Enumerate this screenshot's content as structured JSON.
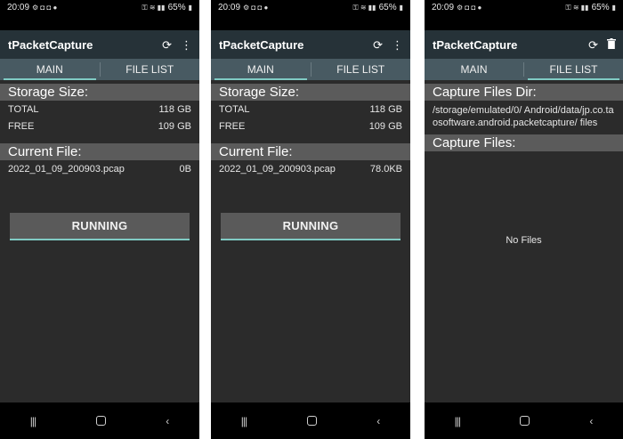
{
  "status": {
    "time": "20:09",
    "battery": "65%"
  },
  "app": {
    "title": "tPacketCapture"
  },
  "tabs": {
    "main": "MAIN",
    "file_list": "FILE LIST"
  },
  "main_screens": [
    {
      "storage_header": "Storage Size:",
      "total_label": "TOTAL",
      "total_value": "118 GB",
      "free_label": "FREE",
      "free_value": "109 GB",
      "current_header": "Current File:",
      "file_name": "2022_01_09_200903.pcap",
      "file_size": "0B",
      "button": "RUNNING"
    },
    {
      "storage_header": "Storage Size:",
      "total_label": "TOTAL",
      "total_value": "118 GB",
      "free_label": "FREE",
      "free_value": "109 GB",
      "current_header": "Current File:",
      "file_name": "2022_01_09_200903.pcap",
      "file_size": "78.0KB",
      "button": "RUNNING"
    }
  ],
  "file_list": {
    "dir_header": "Capture Files Dir:",
    "dir_path": "/storage/emulated/0/ Android/data/jp.co.taosoftware.android.packetcapture/ files",
    "files_header": "Capture Files:",
    "empty_text": "No Files"
  },
  "icons": {
    "refresh": "refresh-icon",
    "more": "more-vert-icon",
    "delete": "delete-icon",
    "recents": "recents-nav-icon",
    "home": "home-nav-icon",
    "back": "back-nav-icon"
  },
  "colors": {
    "appbar": "#263238",
    "tabbar": "#485a62",
    "accent": "#80cbc4",
    "background": "#2b2b2b",
    "section": "#5b5b5b"
  }
}
